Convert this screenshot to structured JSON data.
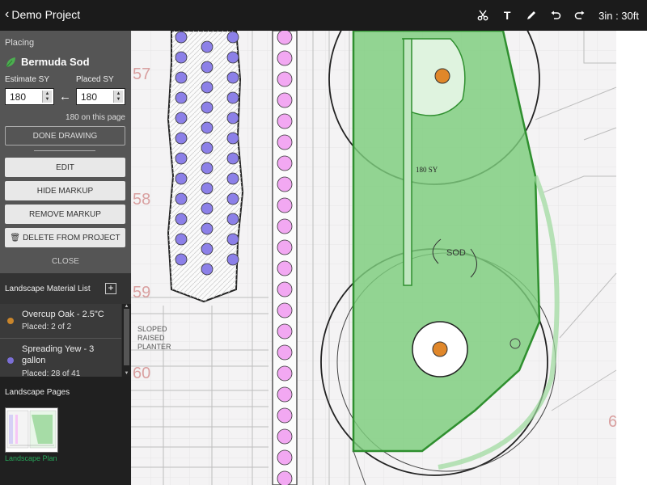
{
  "header": {
    "back_label": "Demo Project",
    "scale": "3in : 30ft",
    "tools": [
      "scissors-icon",
      "text-icon",
      "pen-icon",
      "undo-icon",
      "redo-icon"
    ]
  },
  "placing": {
    "label": "Placing",
    "material": "Bermuda Sod",
    "estimate_label": "Estimate SY",
    "estimate_value": "180",
    "placed_label": "Placed SY",
    "placed_value": "180",
    "on_page": "180 on this page",
    "done_drawing": "DONE DRAWING",
    "edit": "EDIT",
    "hide_markup": "HIDE MARKUP",
    "remove_markup": "REMOVE MARKUP",
    "delete": "DELETE FROM PROJECT",
    "close": "CLOSE"
  },
  "list": {
    "title": "Landscape Material List",
    "items": [
      {
        "name": "Overcup Oak - 2.5\"C",
        "placed": "Placed: 2 of 2",
        "color": "#c9852b"
      },
      {
        "name": "Spreading Yew - 3 gallon",
        "placed": "Placed: 28 of 41",
        "color": "#7b6fd6"
      }
    ]
  },
  "pages": {
    "title": "Landscape Pages",
    "items": [
      {
        "label": "Landscape Plan"
      }
    ]
  },
  "plan": {
    "sod_area": "180 SY",
    "sod_label": "SOD",
    "planter_label": [
      "SLOPED",
      "RAISED",
      "PLANTER"
    ]
  },
  "colors": {
    "sod_fill": "#7ccd7c",
    "sod_outline": "#2f8f2f",
    "shrub_fill": "#8c80e8",
    "flower_fill": "#f2a8f2",
    "tree_fill": "#e0872a",
    "accent": "#27a85a"
  }
}
